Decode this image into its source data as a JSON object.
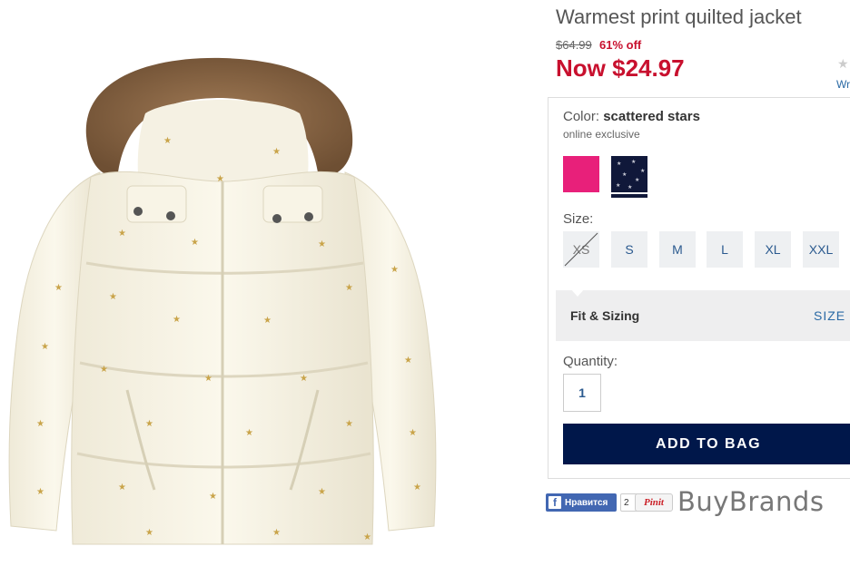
{
  "product": {
    "title": "Warmest print quilted jacket",
    "original_price": "$64.99",
    "discount": "61% off",
    "now_price": "Now $24.97",
    "rating_star": "★",
    "write_review": "Wr"
  },
  "color": {
    "label": "Color:",
    "selected": "scattered stars",
    "note": "online exclusive",
    "swatches": [
      {
        "name": "pink",
        "hex": "#e8207a"
      },
      {
        "name": "scattered stars",
        "hex": "#10183a",
        "selected": true
      }
    ]
  },
  "size": {
    "label": "Size:",
    "options": [
      {
        "label": "XS",
        "available": false
      },
      {
        "label": "S",
        "available": true
      },
      {
        "label": "M",
        "available": true
      },
      {
        "label": "L",
        "available": true
      },
      {
        "label": "XL",
        "available": true
      },
      {
        "label": "XXL",
        "available": true
      }
    ]
  },
  "fit": {
    "label": "Fit & Sizing",
    "link": "SIZE C"
  },
  "quantity": {
    "label": "Quantity:",
    "value": "1"
  },
  "add_to_bag": "ADD TO BAG",
  "social": {
    "fb_label": "Нравится",
    "fb_icon": "f",
    "fb_count": "2",
    "pinit_label": "Pinit"
  },
  "brand": "BuyBrands",
  "colors": {
    "price_red": "#c8102e",
    "button_navy": "#00174a",
    "link_blue": "#2b6aa5"
  }
}
